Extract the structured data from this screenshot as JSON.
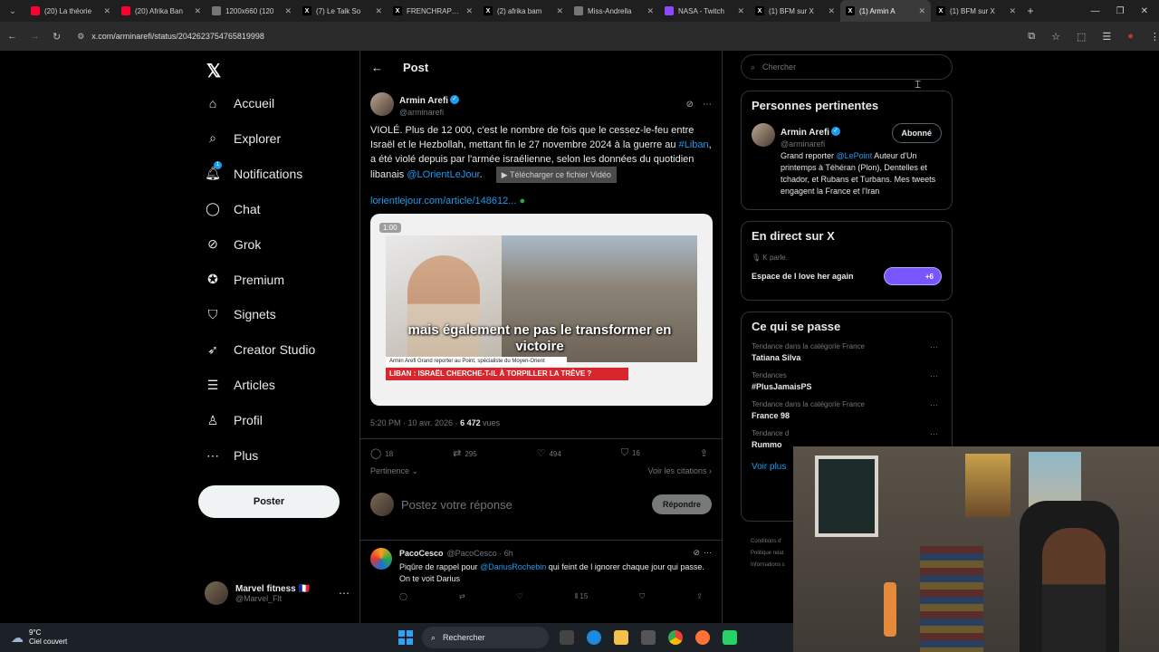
{
  "browser": {
    "tabs": [
      {
        "title": "(20) La théorie",
        "icon": "youtube-icon",
        "color": "#ff0033"
      },
      {
        "title": "(20) Afrika Ban",
        "icon": "youtube-icon",
        "color": "#ff0033"
      },
      {
        "title": "1200x660 (120",
        "icon": "globe-icon",
        "color": "#777777"
      },
      {
        "title": "(7) Le Talk So",
        "icon": "x-icon",
        "color": "#000000"
      },
      {
        "title": "FRENCHRAPUS",
        "icon": "x-icon",
        "color": "#000000"
      },
      {
        "title": "(2) afrika bam",
        "icon": "x-icon",
        "color": "#000000"
      },
      {
        "title": "Miss-Andrella",
        "icon": "globe-icon",
        "color": "#777777"
      },
      {
        "title": "NASA - Twitch",
        "icon": "twitch-icon",
        "color": "#9146ff"
      },
      {
        "title": "(1) BFM sur X",
        "icon": "x-icon",
        "color": "#000000"
      },
      {
        "title": "(1) Armin A",
        "icon": "x-icon",
        "color": "#000000",
        "active": true
      },
      {
        "title": "(1) BFM sur X",
        "icon": "x-icon",
        "color": "#000000"
      }
    ],
    "url": "x.com/arminarefi/status/2042623754765819998"
  },
  "nav": {
    "items": [
      {
        "label": "Accueil",
        "icon": "home-icon",
        "glyph": "⌂"
      },
      {
        "label": "Explorer",
        "icon": "search-icon",
        "glyph": "⌕"
      },
      {
        "label": "Notifications",
        "icon": "bell-icon",
        "glyph": "🔔︎",
        "badge": "1"
      },
      {
        "label": "Chat",
        "icon": "chat-icon",
        "glyph": "◯"
      },
      {
        "label": "Grok",
        "icon": "grok-icon",
        "glyph": "⊘"
      },
      {
        "label": "Premium",
        "icon": "premium-icon",
        "glyph": "✪"
      },
      {
        "label": "Signets",
        "icon": "bookmark-icon",
        "glyph": "⛉"
      },
      {
        "label": "Creator Studio",
        "icon": "rocket-icon",
        "glyph": "➶"
      },
      {
        "label": "Articles",
        "icon": "article-icon",
        "glyph": "☰"
      },
      {
        "label": "Profil",
        "icon": "profile-icon",
        "glyph": "♙"
      },
      {
        "label": "Plus",
        "icon": "more-icon",
        "glyph": "⋯"
      }
    ],
    "post_button": "Poster",
    "account": {
      "name": "Marvel fitness 🇫🇷",
      "handle": "@Marvel_Flt"
    }
  },
  "post": {
    "header": "Post",
    "author": {
      "name": "Armin Arefi",
      "handle": "@arminarefi"
    },
    "text_parts": {
      "p1": "VIOLÉ. Plus de 12 000, c'est le nombre de fois que le cessez-le-feu entre Israël et le Hezbollah, mettant fin le 27 novembre 2024 à la guerre au ",
      "hashtag": "#Liban",
      "p2": ", a été violé depuis par l'armée israélienne, selon les données du quotidien libanais ",
      "mention": "@LOrientLeJour",
      "p3": "."
    },
    "download_overlay": "▶ Télécharger ce fichier Vidéo",
    "link": "lorientlejour.com/article/148612...",
    "video": {
      "timestamp": "1:00",
      "caption": "mais également ne pas le transformer en victoire",
      "credit": "Armin Arefi  Grand reporter au Point, spécialiste du Moyen-Orient",
      "banner": "LIBAN : ISRAËL CHERCHE-T-IL À TORPILLER LA TRÊVE ?"
    },
    "meta": {
      "time": "5:20 PM · 10 avr. 2026 · ",
      "views": "6 472",
      "views_label": " vues"
    },
    "stats": {
      "replies": "18",
      "reposts": "295",
      "likes": "494",
      "bookmarks": "16"
    },
    "sort_label": "Pertinence",
    "quotes_label": "Voir les citations",
    "reply_placeholder": "Postez votre réponse",
    "reply_button": "Répondre"
  },
  "reply": {
    "name": "PacoCesco",
    "handle": "@PacoCesco · 6h",
    "text_a": "Piqûre de rappel pour ",
    "mention": "@DariusRochebin",
    "text_b": " qui feint de l ignorer chaque jour qui passe. On te voit Darius",
    "views": "15"
  },
  "sidebar": {
    "search_placeholder": "Chercher",
    "relevant": {
      "title": "Personnes pertinentes",
      "name": "Armin Arefi",
      "handle": "@arminarefi",
      "follow": "Abonné",
      "bio_a": "Grand reporter ",
      "bio_mention": "@LePoint",
      "bio_b": " Auteur d'Un printemps à Téhéran (Plon), Dentelles et tchador, et Rubans et Turbans. Mes tweets engagent la France et l'Iran"
    },
    "live": {
      "title": "En direct sur X",
      "host": "K parle.",
      "space": "Espace de I love her again",
      "count": "+6"
    },
    "trends": {
      "title": "Ce qui se passe",
      "items": [
        {
          "category": "Tendance dans la catégorie France",
          "name": "Tatiana Silva"
        },
        {
          "category": "Tendances",
          "name": "#PlusJamaisPS"
        },
        {
          "category": "Tendance dans la catégorie France",
          "name": "France 98"
        },
        {
          "category": "Tendance d",
          "name": "Rummo"
        }
      ],
      "more": "Voir plus"
    },
    "footer": [
      "Conditions d'",
      "Politique relat",
      "Informations s"
    ]
  },
  "taskbar": {
    "temp": "9°C",
    "weather": "Ciel couvert",
    "search": "Rechercher"
  }
}
